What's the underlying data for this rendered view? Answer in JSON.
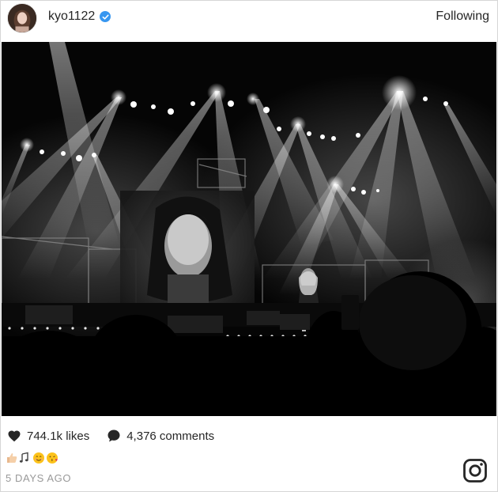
{
  "post": {
    "username": "kyo1122",
    "follow_label": "Following",
    "likes": "744.1k likes",
    "comments": "4,376 comments",
    "timestamp": "5 DAYS AGO"
  },
  "icons": {
    "verified": "verified-badge-icon",
    "like": "heart-icon",
    "comment": "comment-bubble-icon",
    "brand": "instagram-icon"
  },
  "caption_emojis": [
    "thumbs-up",
    "music-notes",
    "smiling-face",
    "kissing-face"
  ],
  "colors": {
    "verified": "#3897f0",
    "text": "#262626",
    "muted": "#999999",
    "photo_bg": "#000000"
  }
}
